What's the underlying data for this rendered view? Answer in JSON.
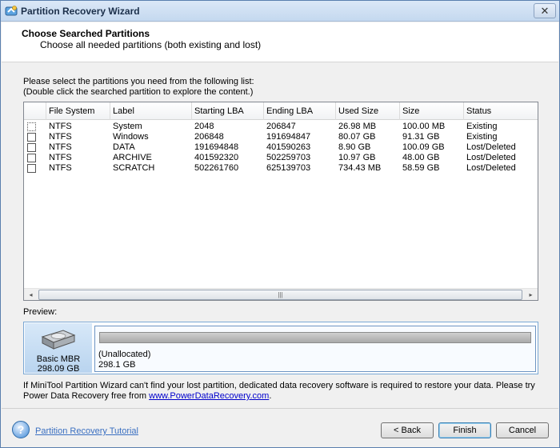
{
  "window": {
    "title": "Partition Recovery Wizard",
    "close_glyph": "✕"
  },
  "header": {
    "title": "Choose Searched Partitions",
    "subtitle": "Choose all needed partitions (both existing and lost)"
  },
  "instructions": {
    "line1": "Please select the partitions you need from the following list:",
    "line2": "(Double click the searched partition to explore the content.)"
  },
  "partition_table": {
    "columns": [
      "File System",
      "Label",
      "Starting LBA",
      "Ending LBA",
      "Used Size",
      "Size",
      "Status"
    ],
    "rows": [
      {
        "checked": false,
        "file_system": "NTFS",
        "label": "System",
        "starting_lba": "2048",
        "ending_lba": "206847",
        "used_size": "26.98 MB",
        "size": "100.00 MB",
        "status": "Existing"
      },
      {
        "checked": false,
        "file_system": "NTFS",
        "label": "Windows",
        "starting_lba": "206848",
        "ending_lba": "191694847",
        "used_size": "80.07 GB",
        "size": "91.31 GB",
        "status": "Existing"
      },
      {
        "checked": false,
        "file_system": "NTFS",
        "label": "DATA",
        "starting_lba": "191694848",
        "ending_lba": "401590263",
        "used_size": "8.90 GB",
        "size": "100.09 GB",
        "status": "Lost/Deleted"
      },
      {
        "checked": false,
        "file_system": "NTFS",
        "label": "ARCHIVE",
        "starting_lba": "401592320",
        "ending_lba": "502259703",
        "used_size": "10.97 GB",
        "size": "48.00 GB",
        "status": "Lost/Deleted"
      },
      {
        "checked": false,
        "file_system": "NTFS",
        "label": "SCRATCH",
        "starting_lba": "502261760",
        "ending_lba": "625139703",
        "used_size": "734.43 MB",
        "size": "58.59 GB",
        "status": "Lost/Deleted"
      }
    ],
    "scrollbar": {
      "left_glyph": "◂",
      "right_glyph": "▸",
      "thumb_grip": "|||"
    }
  },
  "preview": {
    "label": "Preview:",
    "disk": {
      "name": "Basic MBR",
      "size": "298.09 GB",
      "icon": "hard-disk-icon"
    },
    "partition": {
      "name": "(Unallocated)",
      "size": "298.1 GB"
    }
  },
  "note": {
    "line1": "If MiniTool Partition Wizard can't find your lost partition, dedicated data recovery software is required to restore your data. Please try",
    "line2_prefix": "Power Data Recovery free from ",
    "link_text": "www.PowerDataRecovery.com",
    "line2_suffix": "."
  },
  "footer": {
    "help_icon": "help-icon",
    "help_glyph": "?",
    "tutorial_link": "Partition Recovery Tutorial",
    "back_button": "< Back",
    "finish_button": "Finish",
    "cancel_button": "Cancel"
  }
}
